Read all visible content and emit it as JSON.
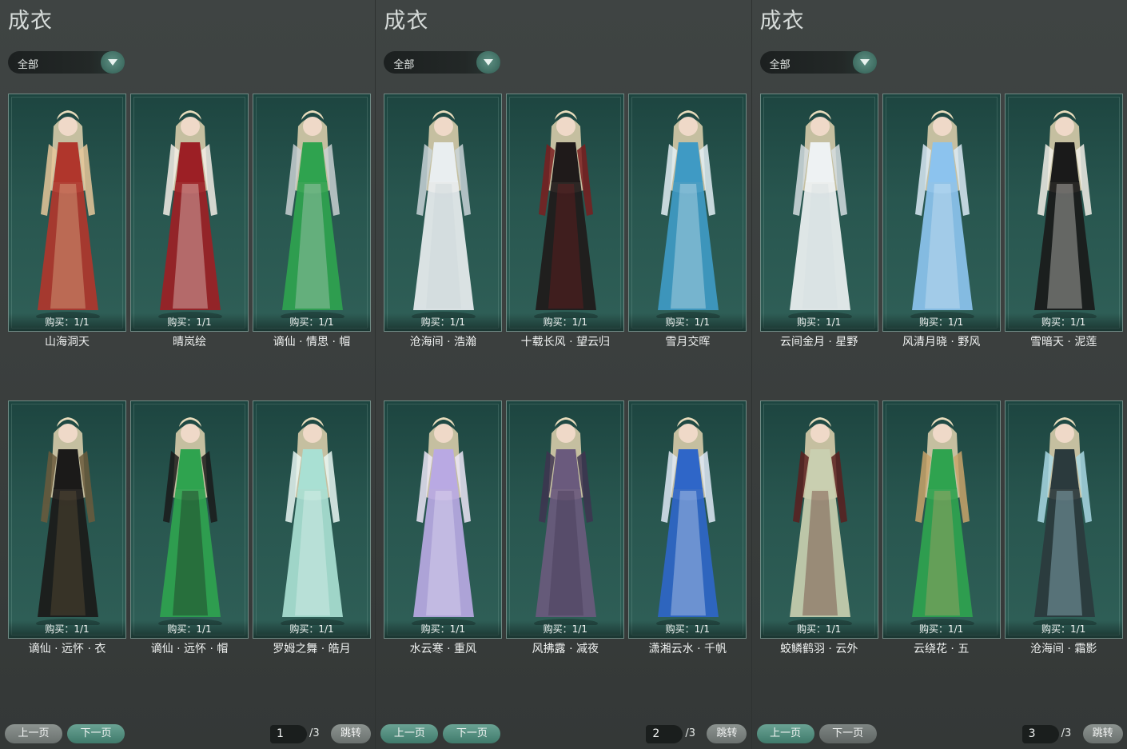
{
  "panels": [
    {
      "title": "成衣",
      "filter": "全部",
      "prev_label": "上一页",
      "next_label": "下一页",
      "page_current": "1",
      "page_total": "/3",
      "jump_label": "跳转",
      "items": [
        {
          "buy": "购买：1/1",
          "name": "山海洞天",
          "colors": [
            "#b0362c",
            "#e6c79a"
          ]
        },
        {
          "buy": "购买：1/1",
          "name": "晴岚绘",
          "colors": [
            "#9c1f25",
            "#f3ede6"
          ]
        },
        {
          "buy": "购买：1/1",
          "name": "谪仙 · 情思 · 帽",
          "colors": [
            "#2fa34f",
            "#c9d0d2"
          ]
        },
        {
          "buy": "购买：1/1",
          "name": "谪仙 · 远怀 · 衣",
          "colors": [
            "#1b1a19",
            "#6b5a3c"
          ]
        },
        {
          "buy": "购买：1/1",
          "name": "谪仙 · 远怀 · 帽",
          "colors": [
            "#2fa34f",
            "#1a1a1a"
          ]
        },
        {
          "buy": "购买：1/1",
          "name": "罗姆之舞 · 皓月",
          "colors": [
            "#a9e0d3",
            "#e9f7f3"
          ]
        }
      ]
    },
    {
      "title": "成衣",
      "filter": "全部",
      "prev_label": "上一页",
      "next_label": "下一页",
      "page_current": "2",
      "page_total": "/3",
      "jump_label": "跳转",
      "items": [
        {
          "buy": "购买：1/1",
          "name": "沧海间 · 浩瀚",
          "colors": [
            "#e9eef0",
            "#c9d4d8"
          ]
        },
        {
          "buy": "购买：1/1",
          "name": "十载长风 · 望云归",
          "colors": [
            "#1f1a1a",
            "#7a1d1f"
          ]
        },
        {
          "buy": "购买：1/1",
          "name": "雪月交晖",
          "colors": [
            "#3f9ac4",
            "#e3eef4"
          ]
        },
        {
          "buy": "购买：1/1",
          "name": "水云寒 · 重风",
          "colors": [
            "#b9a9e3",
            "#ece6f7"
          ]
        },
        {
          "buy": "购买：1/1",
          "name": "风拂露 · 减夜",
          "colors": [
            "#6a5a7d",
            "#3e3450"
          ]
        },
        {
          "buy": "购买：1/1",
          "name": "潇湘云水 · 千帆",
          "colors": [
            "#2f66c8",
            "#dfe9f6"
          ]
        }
      ]
    },
    {
      "title": "成衣",
      "filter": "全部",
      "prev_label": "上一页",
      "next_label": "下一页",
      "page_current": "3",
      "page_total": "/3",
      "jump_label": "跳转",
      "items": [
        {
          "buy": "购买：1/1",
          "name": "云间金月 · 星野",
          "colors": [
            "#eef2f3",
            "#d5dde0"
          ]
        },
        {
          "buy": "购买：1/1",
          "name": "风清月晓 · 野风",
          "colors": [
            "#8cc3ee",
            "#dbeaf6"
          ]
        },
        {
          "buy": "购买：1/1",
          "name": "雪暗天 · 泥莲",
          "colors": [
            "#1a1a1a",
            "#f2efe8"
          ]
        },
        {
          "buy": "购买：1/1",
          "name": "蛟鳞鹤羽 · 云外",
          "colors": [
            "#c9cfb0",
            "#5a1e1e"
          ]
        },
        {
          "buy": "购买：1/1",
          "name": "云绕花 · 五",
          "colors": [
            "#2fa34f",
            "#c9a36a"
          ]
        },
        {
          "buy": "购买：1/1",
          "name": "沧海间 · 霜影",
          "colors": [
            "#2b3a3d",
            "#a9d8e4"
          ]
        }
      ]
    }
  ]
}
